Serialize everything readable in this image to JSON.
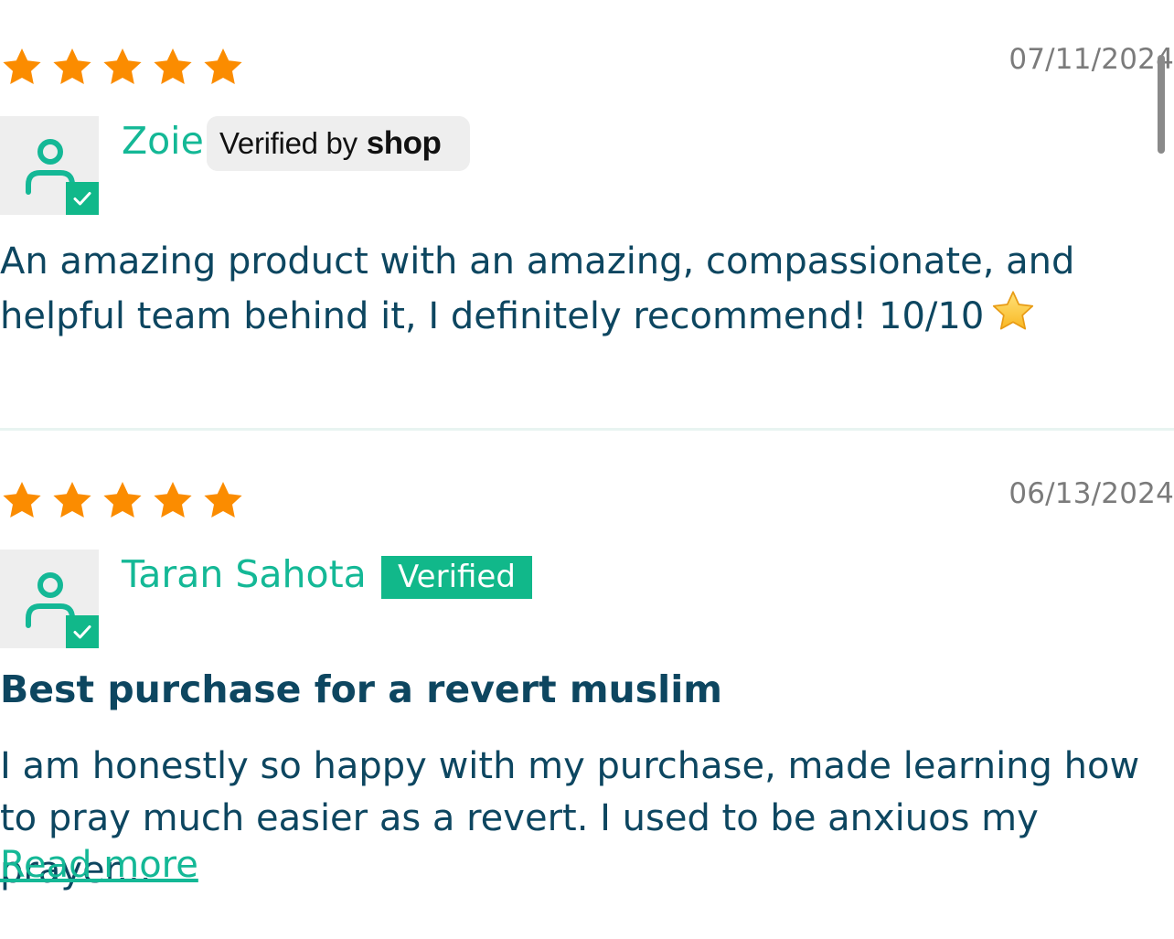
{
  "colors": {
    "star": "#fb8c00",
    "accent": "#11b88a",
    "text": "#0d4660",
    "date": "#7b7b7b"
  },
  "reviews": [
    {
      "rating": 5,
      "date": "07/11/2024",
      "author": "Zoie",
      "badge": {
        "type": "shop",
        "verified_by": "Verified by",
        "shop": "shop"
      },
      "body": "An amazing product with an amazing, compassionate, and helpful team behind it, I definitely recommend! 10/10",
      "emoji": "star-emoji"
    },
    {
      "rating": 5,
      "date": "06/13/2024",
      "author": "Taran Sahota",
      "badge": {
        "type": "verified",
        "label": "Verified"
      },
      "title": "Best purchase for a revert muslim",
      "body": "I am honestly so happy with my purchase, made learning how to pray much easier as a revert. I used to be anxiuos my prayer...",
      "read_more": "Read more"
    }
  ]
}
